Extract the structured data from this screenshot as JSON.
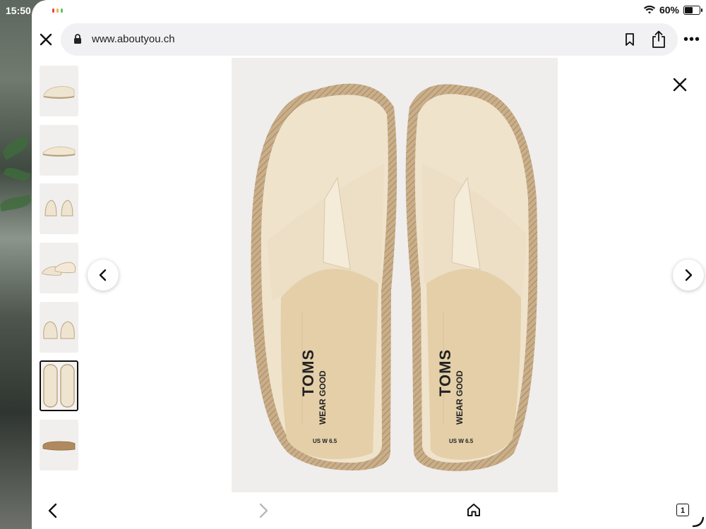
{
  "status_bar": {
    "time": "15:50",
    "battery_percent_label": "60%",
    "battery_level": 0.6,
    "icons": [
      "wifi-icon",
      "battery-icon"
    ]
  },
  "browser": {
    "url": "www.aboutyou.ch",
    "close_icon": "close-icon",
    "lock_icon": "lock-icon",
    "bookmark_icon": "bookmark-icon",
    "share_icon": "share-icon",
    "more_label": "•••"
  },
  "gallery": {
    "thumbnail_count": 7,
    "selected_index": 5,
    "thumbnails": [
      "thumb-side-view",
      "thumb-side-view-2",
      "thumb-front-pair",
      "thumb-angled-pair",
      "thumb-back-pair",
      "thumb-top-view",
      "thumb-sole-view"
    ],
    "main_image_text": {
      "brand": "TOMS",
      "slogan": "WEAR GOOD",
      "size": "US W 6.5"
    },
    "prev_icon": "chevron-left-icon",
    "next_icon": "chevron-right-icon",
    "close_icon": "close-icon"
  },
  "toolbar": {
    "back_icon": "chevron-left-icon",
    "forward_icon": "chevron-right-icon",
    "home_icon": "home-icon",
    "tabs_count": "1"
  },
  "colors": {
    "canvas_beige": "#efe3cc",
    "jute": "#c8ad8a",
    "image_bg": "#efeeec"
  }
}
